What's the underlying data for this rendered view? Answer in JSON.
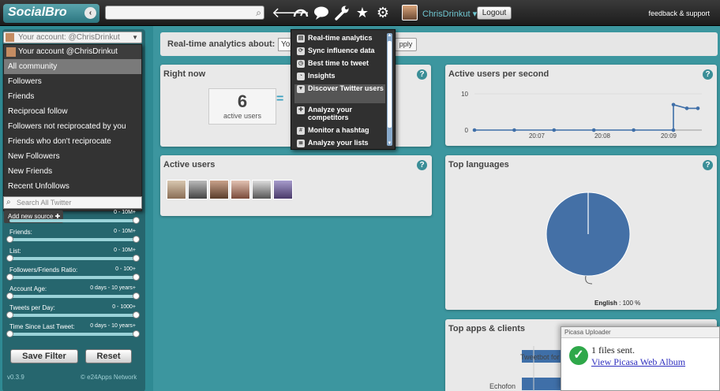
{
  "topbar": {
    "logo": "SocialBro",
    "search_placeholder": "",
    "username": "ChrisDrinkut",
    "logout": "Logout",
    "feedback": "feedback & support",
    "icons": [
      "back-arrow-icon",
      "dashboard-gauge-icon",
      "speech-bubble-icon",
      "wrench-icon",
      "star-icon",
      "gear-icon"
    ]
  },
  "sidebar": {
    "account_select": "Your account: @ChrisDrinkut",
    "dropdown_header": "Your account @ChrisDrinkut",
    "dropdown_items": [
      "All community",
      "Followers",
      "Friends",
      "Reciprocal follow",
      "Followers not reciprocated by you",
      "Friends who don't reciprocate",
      "New Followers",
      "New Friends",
      "Recent Unfollows"
    ],
    "selected_item": "All community",
    "search_placeholder": "Search All Twitter",
    "add_source": "Add new source",
    "filters": [
      {
        "label": "",
        "range": "0 - 10M+"
      },
      {
        "label": "Friends:",
        "range": "0 - 10M+"
      },
      {
        "label": "List:",
        "range": "0 - 10M+"
      },
      {
        "label": "Followers/Friends Ratio:",
        "range": "0 - 100+"
      },
      {
        "label": "Account Age:",
        "range": "0 days - 10 years+"
      },
      {
        "label": "Tweets per Day:",
        "range": "0 - 1000+"
      },
      {
        "label": "Time Since Last Tweet:",
        "range": "0 days - 10 years+"
      }
    ],
    "save_filter": "Save Filter",
    "reset": "Reset",
    "version": "v0.3.9",
    "copyright": "© e24Apps Network"
  },
  "main": {
    "realtime_label": "Real-time analytics about:",
    "realtime_select": "Yo",
    "apply": "pply",
    "right_now": {
      "title": "Right now",
      "count": "6",
      "count_label": "active users"
    },
    "active_users_per_second": {
      "title": "Active users per second"
    },
    "active_users": {
      "title": "Active users"
    },
    "top_languages": {
      "title": "Top languages",
      "legend_lang": "English",
      "legend_value": ": 100 %"
    },
    "top_apps": {
      "title": "Top apps & clients",
      "rows": [
        "Tweetbot for iOS",
        "Echofon"
      ],
      "value_1": "1"
    }
  },
  "dropdown_menu": {
    "items": [
      "Real-time analytics",
      "Sync influence data",
      "Best time to tweet",
      "Insights",
      "Discover Twitter users",
      "Analyze your competitors",
      "Monitor a hashtag",
      "Analyze your lists"
    ],
    "highlighted": "Discover Twitter users"
  },
  "popup": {
    "title": "Picasa Uploader",
    "message": "1 files sent.",
    "link": "View Picasa Web Album"
  },
  "chart_data": [
    {
      "type": "line",
      "title": "Active users per second",
      "x_ticks": [
        "20:07",
        "20:08",
        "20:09"
      ],
      "y_ticks": [
        0,
        10
      ],
      "ylim": [
        0,
        10
      ],
      "series": [
        {
          "values": [
            0,
            0,
            0,
            0,
            0,
            0,
            0,
            0,
            0,
            0,
            0,
            0,
            0,
            0,
            0,
            0,
            7,
            6,
            6
          ]
        }
      ]
    },
    {
      "type": "pie",
      "title": "Top languages",
      "categories": [
        "English"
      ],
      "values": [
        100
      ]
    },
    {
      "type": "bar",
      "title": "Top apps & clients",
      "categories": [
        "Tweetbot for iOS",
        "Echofon"
      ],
      "values": [
        1,
        1
      ]
    }
  ],
  "colors": {
    "accent": "#3c969f",
    "line": "#3f6fa8",
    "pie": "#4470a6"
  }
}
